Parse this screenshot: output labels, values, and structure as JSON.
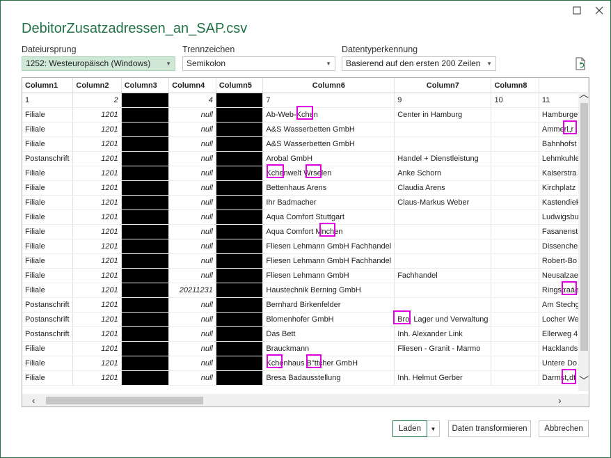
{
  "window": {
    "title": "DebitorZusatzadressen_an_SAP.csv"
  },
  "options": {
    "file_origin_label": "Dateiursprung",
    "file_origin_value": "1252: Westeuropäisch (Windows)",
    "delimiter_label": "Trennzeichen",
    "delimiter_value": "Semikolon",
    "type_detection_label": "Datentyperkennung",
    "type_detection_value": "Basierend auf den ersten 200 Zeilen"
  },
  "table": {
    "headers": [
      "Column1",
      "Column2",
      "Column3",
      "Column4",
      "Column5",
      "Column6",
      "Column7",
      "Column8"
    ],
    "first_row": {
      "c1": "1",
      "c2": "2",
      "c4": "4",
      "c6": "7",
      "c7": "9",
      "c8": "10",
      "c9": "11"
    },
    "rows": [
      {
        "c1": "Filiale",
        "c2": "1201",
        "c4": "null",
        "c6": "Ab-Web-Kchen",
        "c7": "Center in Hamburg",
        "c9": "Hamburge"
      },
      {
        "c1": "Filiale",
        "c2": "1201",
        "c4": "null",
        "c6": "A&S Wasserbetten GmbH",
        "c7": "",
        "c9": "Ammerl„r"
      },
      {
        "c1": "Filiale",
        "c2": "1201",
        "c4": "null",
        "c6": "A&S Wasserbetten GmbH",
        "c7": "",
        "c9": "Bahnhofst"
      },
      {
        "c1": "Postanschrift",
        "c2": "1201",
        "c4": "null",
        "c6": "Arobal GmbH",
        "c7": "Handel + Dienstleistung",
        "c9": "Lehmkuhle"
      },
      {
        "c1": "Filiale",
        "c2": "1201",
        "c4": "null",
        "c6": "Kchenwelt Wrselen",
        "c7": "Anke Schorn",
        "c9": "Kaiserstra"
      },
      {
        "c1": "Filiale",
        "c2": "1201",
        "c4": "null",
        "c6": "Bettenhaus Arens",
        "c7": "Claudia Arens",
        "c9": "Kirchplatz"
      },
      {
        "c1": "Filiale",
        "c2": "1201",
        "c4": "null",
        "c6": "Ihr Badmacher",
        "c7": "Claus-Markus Weber",
        "c9": "Kastendiek"
      },
      {
        "c1": "Filiale",
        "c2": "1201",
        "c4": "null",
        "c6": "Aqua Comfort Stuttgart",
        "c7": "",
        "c9": "Ludwigsbu"
      },
      {
        "c1": "Filiale",
        "c2": "1201",
        "c4": "null",
        "c6": "Aqua Comfort Mnchen",
        "c7": "",
        "c9": "Fasanenst"
      },
      {
        "c1": "Filiale",
        "c2": "1201",
        "c4": "null",
        "c6": "Fliesen Lehmann GmbH Fachhandel",
        "c7": "",
        "c9": "Dissenche"
      },
      {
        "c1": "Filiale",
        "c2": "1201",
        "c4": "null",
        "c6": "Fliesen Lehmann GmbH Fachhandel",
        "c7": "",
        "c9": "Robert-Bo"
      },
      {
        "c1": "Filiale",
        "c2": "1201",
        "c4": "null",
        "c6": "Fliesen Lehmann GmbH",
        "c7": "Fachhandel",
        "c9": "Neusalzae"
      },
      {
        "c1": "Filiale",
        "c2": "1201",
        "c4": "20211231",
        "c6": "Haustechnik Berning GmbH",
        "c7": "",
        "c9": "Ringstraáe"
      },
      {
        "c1": "Postanschrift",
        "c2": "1201",
        "c4": "null",
        "c6": "Bernhard Birkenfelder",
        "c7": "",
        "c9": "Am Stechg"
      },
      {
        "c1": "Postanschrift",
        "c2": "1201",
        "c4": "null",
        "c6": "Blomenhofer GmbH",
        "c7": "Bro, Lager und Verwaltung",
        "c9": "Locher We"
      },
      {
        "c1": "Postanschrift",
        "c2": "1201",
        "c4": "null",
        "c6": "Das Bett",
        "c7": "Inh. Alexander Link",
        "c9": "Ellerweg 4"
      },
      {
        "c1": "Filiale",
        "c2": "1201",
        "c4": "null",
        "c6": "Brauckmann",
        "c7": "Fliesen - Granit - Marmo",
        "c9": "Hacklands"
      },
      {
        "c1": "Filiale",
        "c2": "1201",
        "c4": "null",
        "c6": "Kchenhaus B\"ttcher GmbH",
        "c7": "",
        "c9": "Untere Do"
      },
      {
        "c1": "Filiale",
        "c2": "1201",
        "c4": "null",
        "c6": "Bresa Badausstellung",
        "c7": "Inh. Helmut Gerber",
        "c9": "Darmst„dt"
      }
    ]
  },
  "buttons": {
    "load": "Laden",
    "transform": "Daten transformieren",
    "cancel": "Abbrechen"
  }
}
